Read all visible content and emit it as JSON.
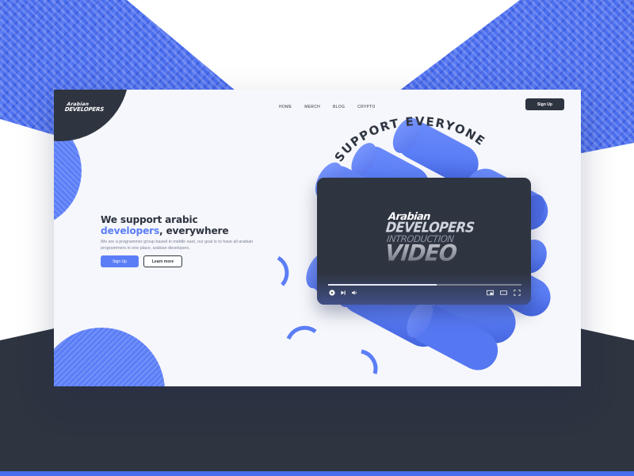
{
  "colors": {
    "accent": "#5b7ef7",
    "dark": "#2e3440",
    "card_bg": "#f6f7fc",
    "muted_text": "#7b8294"
  },
  "logo": {
    "line1": "Arabian",
    "line2": "DEVELOPERS"
  },
  "nav": {
    "items": [
      "HOME",
      "MERCH",
      "BLOG",
      "CRYPTO"
    ],
    "signup_label": "Sign Up"
  },
  "hero": {
    "title_line1": "We support arabic",
    "title_accent": "developers",
    "title_end": ", everywhere",
    "subtitle": "We are a programmer group based in middle east, our goal is to have all arabian programmers in one place, arabian developers.",
    "primary_button": "Sign Up",
    "secondary_button": "Learn more"
  },
  "illustration": {
    "arc_text": "SUPPORT EVERYONE"
  },
  "video": {
    "title_brand": "Arabian",
    "title_developers": "DEVELOPERS",
    "title_intro": "INTRODUCTION",
    "title_video": "VIDEO",
    "progress": 0.56,
    "icons": {
      "play": "play-icon",
      "next": "skip-next-icon",
      "volume": "volume-icon",
      "miniplayer": "miniplayer-icon",
      "theater": "theater-mode-icon",
      "fullscreen": "fullscreen-icon"
    }
  }
}
